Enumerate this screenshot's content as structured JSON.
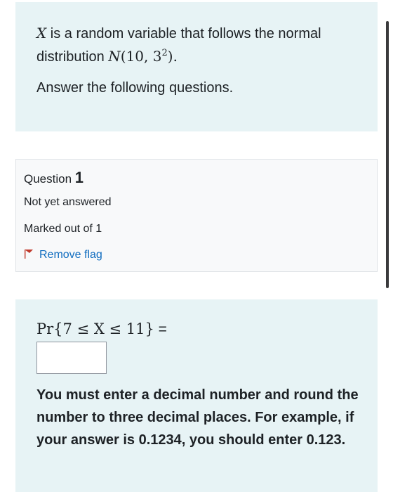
{
  "intro": {
    "line1_rest": " is a random variable that follows the normal",
    "line2_prefix": "distribution ",
    "variable": "X",
    "dist_symbol": "N",
    "dist_args": "(10, 3",
    "dist_exp": "2",
    "dist_close": ").",
    "line3": "Answer the following questions."
  },
  "question_info": {
    "label": "Question",
    "number": "1",
    "state": "Not yet answered",
    "grade": "Marked out of 1",
    "flag_label": "Remove flag"
  },
  "question": {
    "formula": "Pr{7 ≤ X ≤ 11}",
    "equals": " =",
    "answer_value": "",
    "instructions": "You must enter a decimal number and round the number to three decimal places. For example, if your answer is 0.1234, you should enter 0.123."
  },
  "colors": {
    "info_bg": "#e7f3f5",
    "flag": "#c0392b",
    "link": "#0f6cbf"
  },
  "icons": {
    "flag": "flag-icon"
  }
}
